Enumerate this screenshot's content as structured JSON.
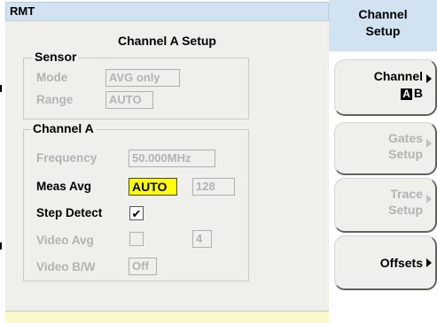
{
  "status_bar": {
    "mode": "RMT"
  },
  "page_title": "Channel A Setup",
  "sensor": {
    "legend": "Sensor",
    "mode": {
      "label": "Mode",
      "value": "AVG only"
    },
    "range": {
      "label": "Range",
      "value": "AUTO"
    }
  },
  "channel": {
    "legend": "Channel A",
    "frequency": {
      "label": "Frequency",
      "value": "50.000MHz"
    },
    "meas_avg": {
      "label": "Meas Avg",
      "value": "AUTO",
      "count": "128"
    },
    "step_detect": {
      "label": "Step Detect",
      "checked": true,
      "check_glyph": "✔"
    },
    "video_avg": {
      "label": "Video Avg",
      "checked": false,
      "value": "4"
    },
    "video_bw": {
      "label": "Video B/W",
      "value": "Off"
    }
  },
  "menu": {
    "title_line1": "Channel",
    "title_line2": "Setup",
    "softkeys": [
      {
        "line1": "Channel",
        "line2_a": "A",
        "line2_b": "B",
        "enabled": true
      },
      {
        "line1": "Gates",
        "line2": "Setup",
        "enabled": false
      },
      {
        "line1": "Trace",
        "line2": "Setup",
        "enabled": false
      },
      {
        "line1": "Offsets",
        "enabled": true
      }
    ]
  },
  "colors": {
    "highlight": "#ffff00",
    "menu_title_bg": "#d1e2f0",
    "panel_bg": "#efefeb",
    "disabled_text": "#b3b3b3",
    "bottom_bar": "#fbf8cc"
  }
}
